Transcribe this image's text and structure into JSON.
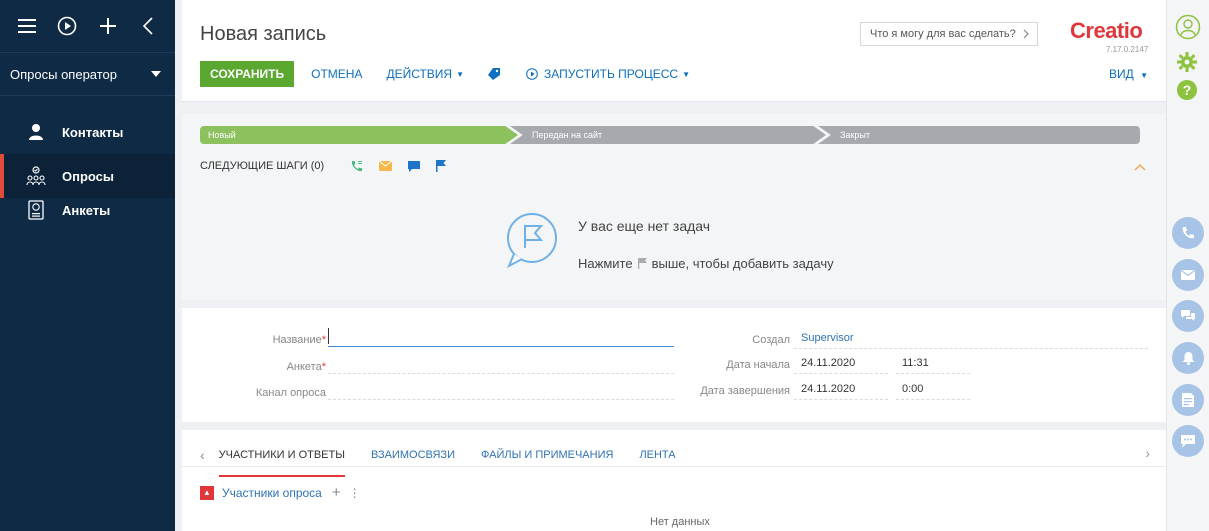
{
  "sidebar": {
    "section": "Опросы оператор",
    "items": [
      {
        "label": "Контакты"
      },
      {
        "label": "Опросы"
      },
      {
        "label": "Анкеты"
      }
    ]
  },
  "header": {
    "title": "Новая запись",
    "search_placeholder": "Что я могу для вас сделать?",
    "logo": "Creatio",
    "version": "7.17.0.2147",
    "toolbar": {
      "save": "СОХРАНИТЬ",
      "cancel": "ОТМЕНА",
      "actions": "ДЕЙСТВИЯ",
      "run_process": "ЗАПУСТИТЬ ПРОЦЕСС",
      "view": "ВИД"
    }
  },
  "stages": [
    "Новый",
    "Передан на сайт",
    "Закрыт"
  ],
  "next_steps": {
    "label": "СЛЕДУЮЩИЕ ШАГИ (0)",
    "empty_title": "У вас еще нет задач",
    "hint_prefix": "Нажмите",
    "hint_suffix": "выше, чтобы добавить задачу"
  },
  "form": {
    "name_label": "Название",
    "questionnaire_label": "Анкета",
    "channel_label": "Канал опроса",
    "created_by_label": "Создал",
    "created_by": "Supervisor",
    "start_label": "Дата начала",
    "start_date": "24.11.2020",
    "start_time": "11:31",
    "end_label": "Дата завершения",
    "end_date": "24.11.2020",
    "end_time": "0:00"
  },
  "tabs": [
    "УЧАСТНИКИ И ОТВЕТЫ",
    "ВЗАИМОСВЯЗИ",
    "ФАЙЛЫ И ПРИМЕЧАНИЯ",
    "ЛЕНТА"
  ],
  "detail": {
    "title": "Участники опроса",
    "empty": "Нет данных"
  },
  "colors": {
    "sidebar_bg": "#0f2a44",
    "save_green": "#5ba830",
    "accent_red": "#e0373a",
    "link_blue": "#0d6fbf",
    "stage_active": "#8cc15d",
    "stage_inactive": "#a6a9ae"
  },
  "icons": {
    "rail": [
      "phone-icon",
      "email-icon",
      "chat-icon",
      "bell-icon",
      "document-icon",
      "message-icon"
    ]
  }
}
